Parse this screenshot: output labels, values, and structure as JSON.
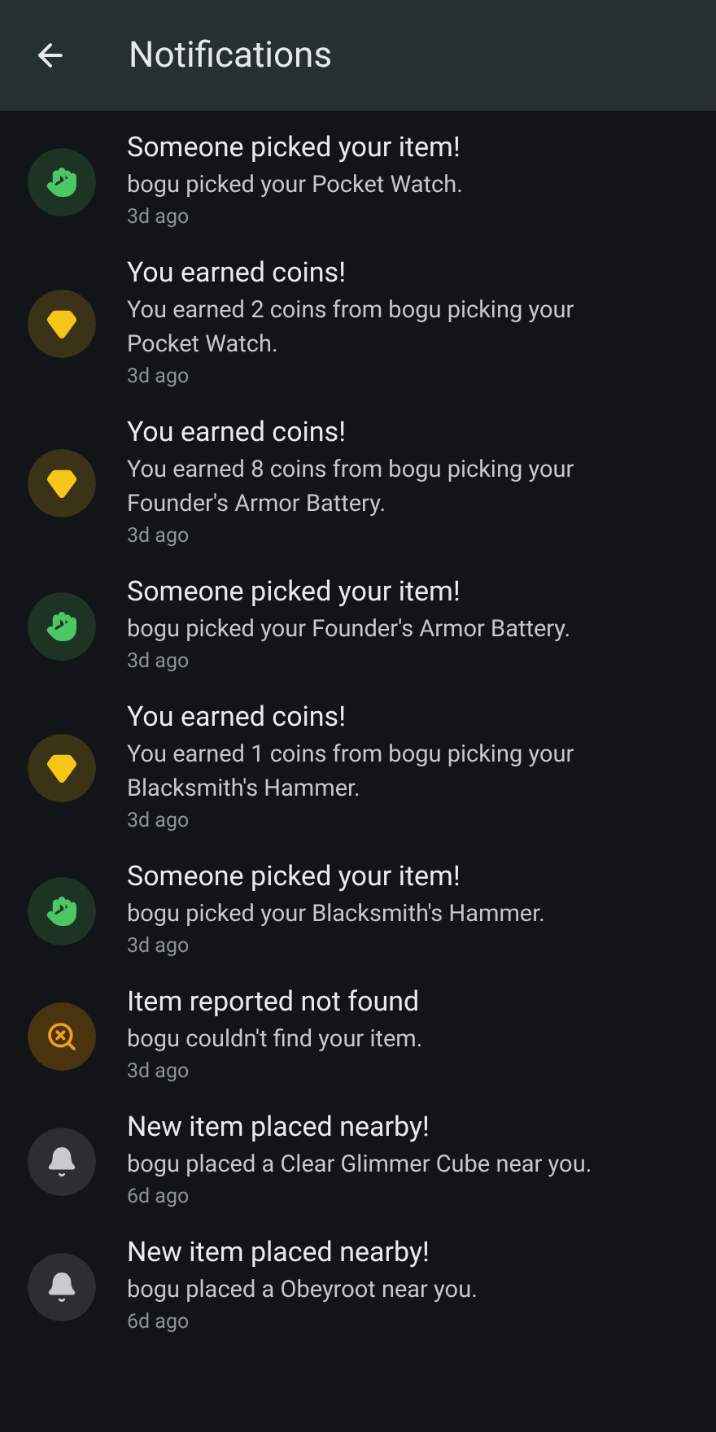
{
  "header": {
    "title": "Notifications"
  },
  "notifications": [
    {
      "kind": "pick",
      "title": "Someone picked your item!",
      "body": "bogu picked your Pocket Watch.",
      "time": "3d ago"
    },
    {
      "kind": "coins",
      "title": "You earned coins!",
      "body": "You earned 2 coins from bogu picking your Pocket Watch.",
      "time": "3d ago"
    },
    {
      "kind": "coins",
      "title": "You earned coins!",
      "body": "You earned 8 coins from bogu picking your Founder's Armor Battery.",
      "time": "3d ago"
    },
    {
      "kind": "pick",
      "title": "Someone picked your item!",
      "body": "bogu picked your Founder's Armor Battery.",
      "time": "3d ago"
    },
    {
      "kind": "coins",
      "title": "You earned coins!",
      "body": "You earned 1 coins from bogu picking your Blacksmith's Hammer.",
      "time": "3d ago"
    },
    {
      "kind": "pick",
      "title": "Someone picked your item!",
      "body": "bogu picked your Blacksmith's Hammer.",
      "time": "3d ago"
    },
    {
      "kind": "not_found",
      "title": "Item reported not found",
      "body": "bogu couldn't find your item.",
      "time": "3d ago"
    },
    {
      "kind": "placed",
      "title": "New item placed nearby!",
      "body": "bogu placed a Clear Glimmer Cube near you.",
      "time": "6d ago"
    },
    {
      "kind": "placed",
      "title": "New item placed nearby!",
      "body": "bogu placed a Obeyroot near you.",
      "time": "6d ago"
    }
  ]
}
